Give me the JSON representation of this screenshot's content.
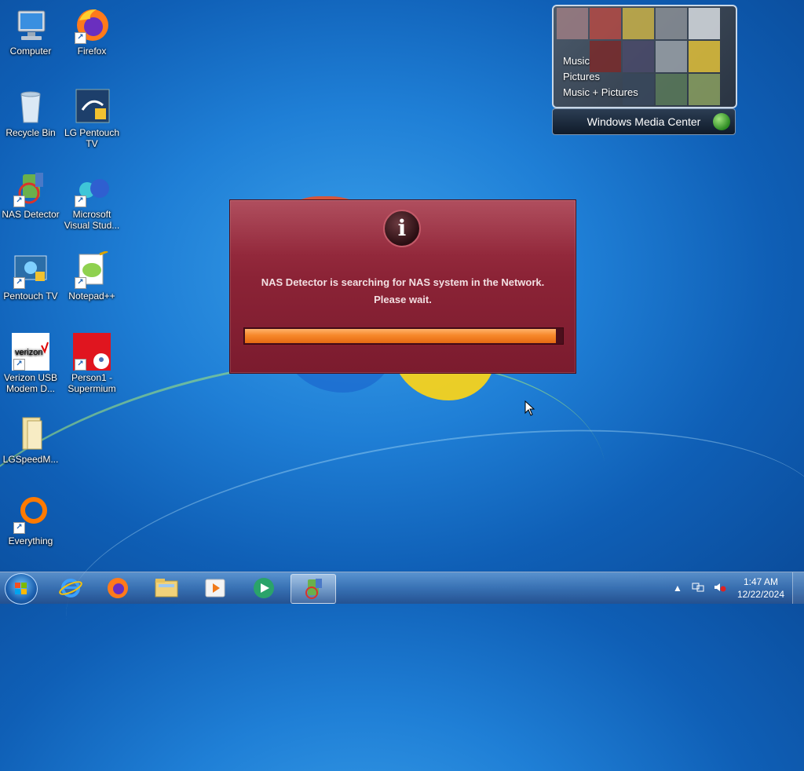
{
  "desktop_icons": [
    {
      "label": "Computer"
    },
    {
      "label": "Firefox"
    },
    {
      "label": "Recycle Bin"
    },
    {
      "label": "LG Pentouch TV"
    },
    {
      "label": "NAS Detector"
    },
    {
      "label": "Microsoft Visual Stud..."
    },
    {
      "label": "Pentouch TV"
    },
    {
      "label": "Notepad++"
    },
    {
      "label": "Verizon USB Modem D..."
    },
    {
      "label": "Person1 - Supermium"
    },
    {
      "label": "LGSpeedM..."
    },
    {
      "label": "Everything"
    }
  ],
  "wmc": {
    "menu": [
      "Music",
      "Pictures",
      "Music + Pictures"
    ],
    "title": "Windows Media Center"
  },
  "dialog": {
    "message_line1": "NAS Detector is searching for NAS system in the Network.",
    "message_line2": "Please wait.",
    "progress": 0.98
  },
  "taskbar": {
    "apps": [
      "internet-explorer",
      "firefox",
      "windows-explorer",
      "media-player",
      "media-center",
      "nas-detector"
    ]
  },
  "tray": {
    "time": "1:47 AM",
    "date": "12/22/2024"
  }
}
